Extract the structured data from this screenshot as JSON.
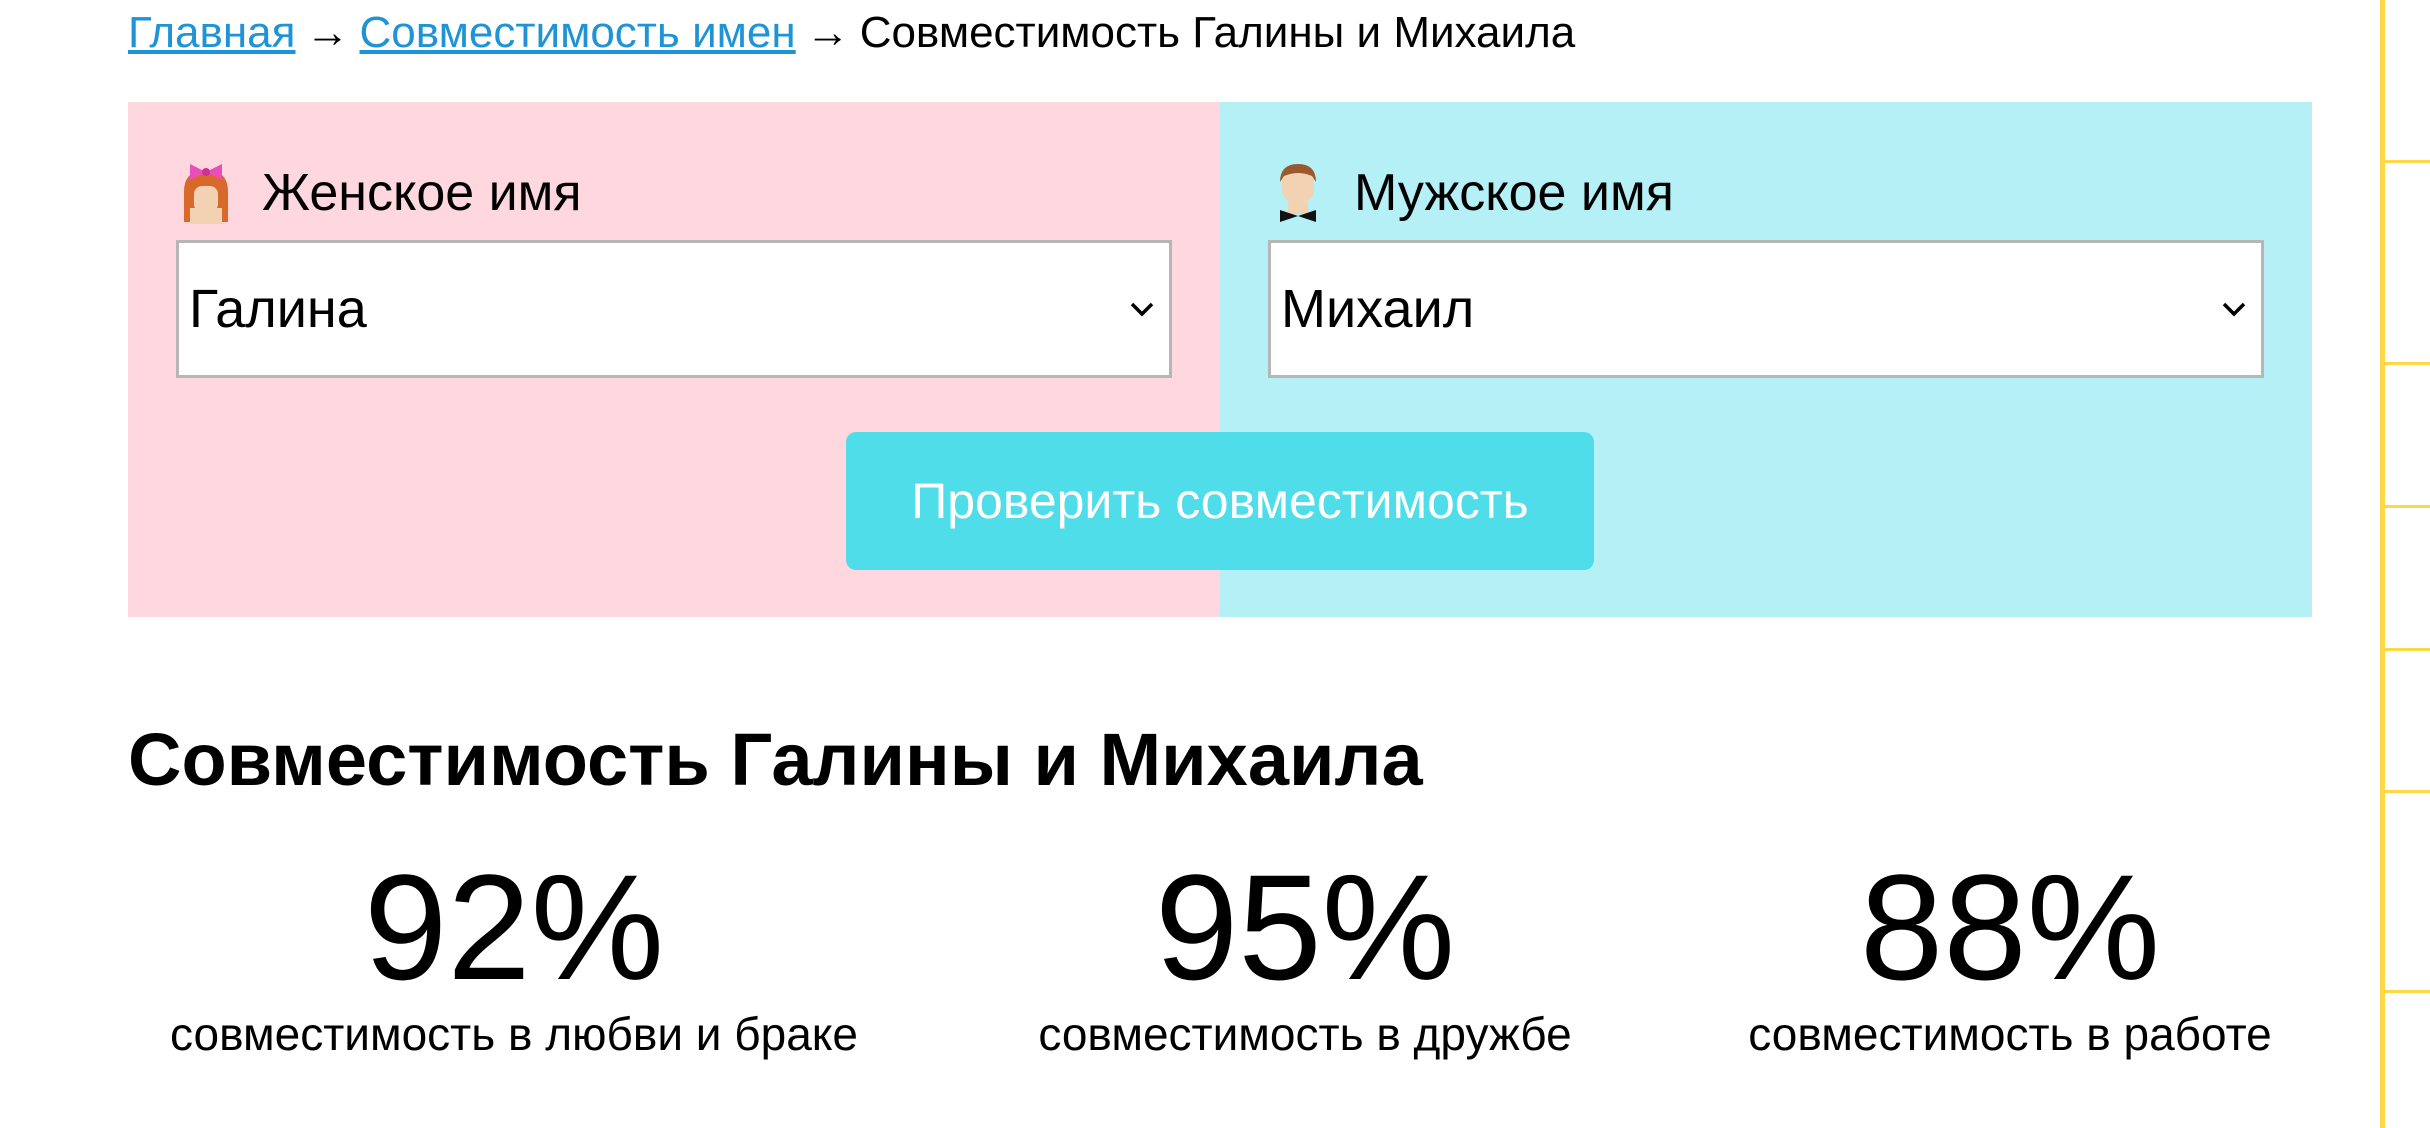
{
  "breadcrumb": {
    "home": "Главная",
    "section": "Совместимость имен",
    "current": "Совместимость Галины и Михаила",
    "separator": "→"
  },
  "form": {
    "female": {
      "label": "Женское имя",
      "icon": "girl-avatar-icon",
      "selected": "Галина"
    },
    "male": {
      "label": "Мужское имя",
      "icon": "boy-avatar-icon",
      "selected": "Михаил"
    },
    "button_label": "Проверить совместимость"
  },
  "result": {
    "title": "Совместимость Галины и Михаила",
    "stats": [
      {
        "value": "92%",
        "caption": "совместимость в любви и браке"
      },
      {
        "value": "95%",
        "caption": "совместимость в дружбе"
      },
      {
        "value": "88%",
        "caption": "совместимость в работе"
      }
    ]
  },
  "colors": {
    "female_bg": "#fed7df",
    "male_bg": "#b5f0f7",
    "button_bg": "#4fdde9",
    "link": "#1e93d6",
    "accent_strip": "#ffd84a"
  }
}
